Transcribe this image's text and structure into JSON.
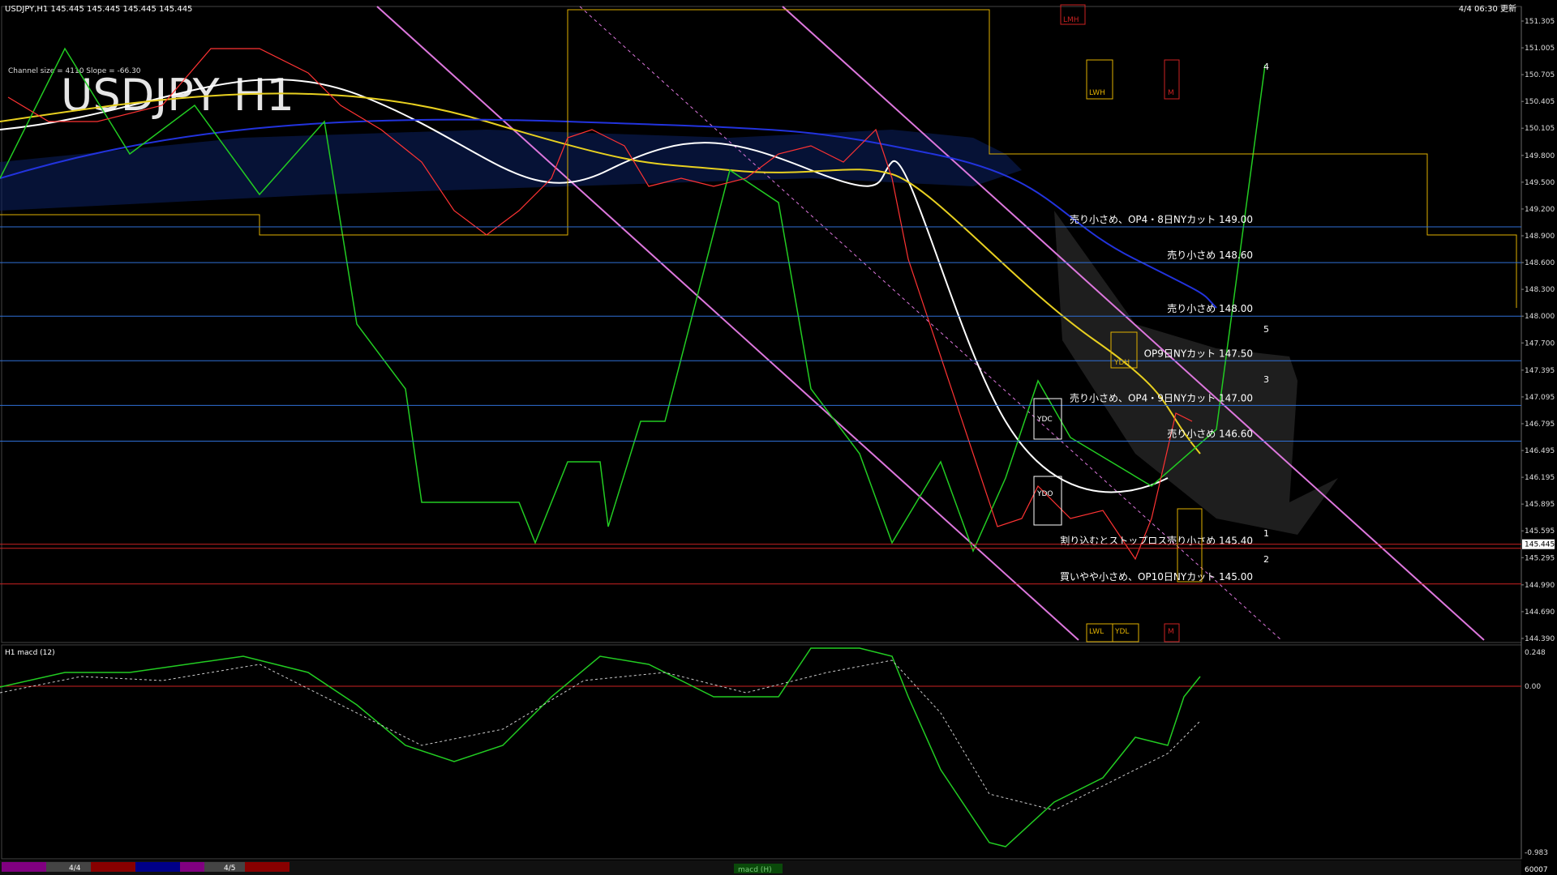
{
  "header": {
    "info": "USDJPY,H1  145.445 145.445 145.445 145.445",
    "timestamp": "4/4 06:30 更新",
    "channel": "Channel size = 4110 Slope = -66.30",
    "big_title": "USDJPY H1"
  },
  "chart_data": [
    {
      "type": "line",
      "title": "USDJPY H1",
      "ylim": [
        144.39,
        151.6
      ],
      "y_ticks": [
        "151.305",
        "151.005",
        "150.705",
        "150.405",
        "150.105",
        "149.800",
        "149.500",
        "149.200",
        "148.900",
        "148.600",
        "148.300",
        "148.000",
        "147.700",
        "147.395",
        "147.095",
        "146.795",
        "146.495",
        "146.195",
        "145.895",
        "145.595",
        "145.295",
        "144.990",
        "144.690",
        "144.390"
      ],
      "current_price": "145.445",
      "levels": [
        {
          "price": 149.0,
          "label": "売り小さめ、OP4・8日NYカット 149.00",
          "color": "#2f6fd6"
        },
        {
          "price": 148.6,
          "label": "売り小さめ 148.60",
          "color": "#2f6fd6"
        },
        {
          "price": 148.0,
          "label": "売り小さめ 148.00",
          "color": "#2f6fd6"
        },
        {
          "price": 147.5,
          "label": "OP9日NYカット 147.50",
          "color": "#2f6fd6"
        },
        {
          "price": 147.0,
          "label": "売り小さめ、OP4・9日NYカット 147.00",
          "color": "#2f6fd6"
        },
        {
          "price": 146.6,
          "label": "売り小さめ 146.60",
          "color": "#2f6fd6"
        },
        {
          "price": 145.4,
          "label": "割り込むとストップロス売り小さめ 145.40",
          "color": "#cc2222"
        },
        {
          "price": 145.0,
          "label": "買いやや小さめ、OP10日NYカット 145.00",
          "color": "#cc2222"
        }
      ],
      "markers": [
        "LMH",
        "LWH",
        "M",
        "YDH",
        "YDC",
        "YDO",
        "LWL",
        "YDL",
        "M"
      ],
      "projection_labels": [
        "4",
        "5",
        "3",
        "1",
        "2"
      ]
    },
    {
      "type": "line",
      "title": "H1 macd (12)",
      "ylim": [
        -0.983,
        0.248
      ],
      "y_ticks": [
        "0.248",
        "0.00",
        "-0.983"
      ]
    }
  ],
  "footer": {
    "dates": [
      "4/4",
      "4/5"
    ],
    "macd_tab": "macd (H)",
    "corner": "60007"
  }
}
